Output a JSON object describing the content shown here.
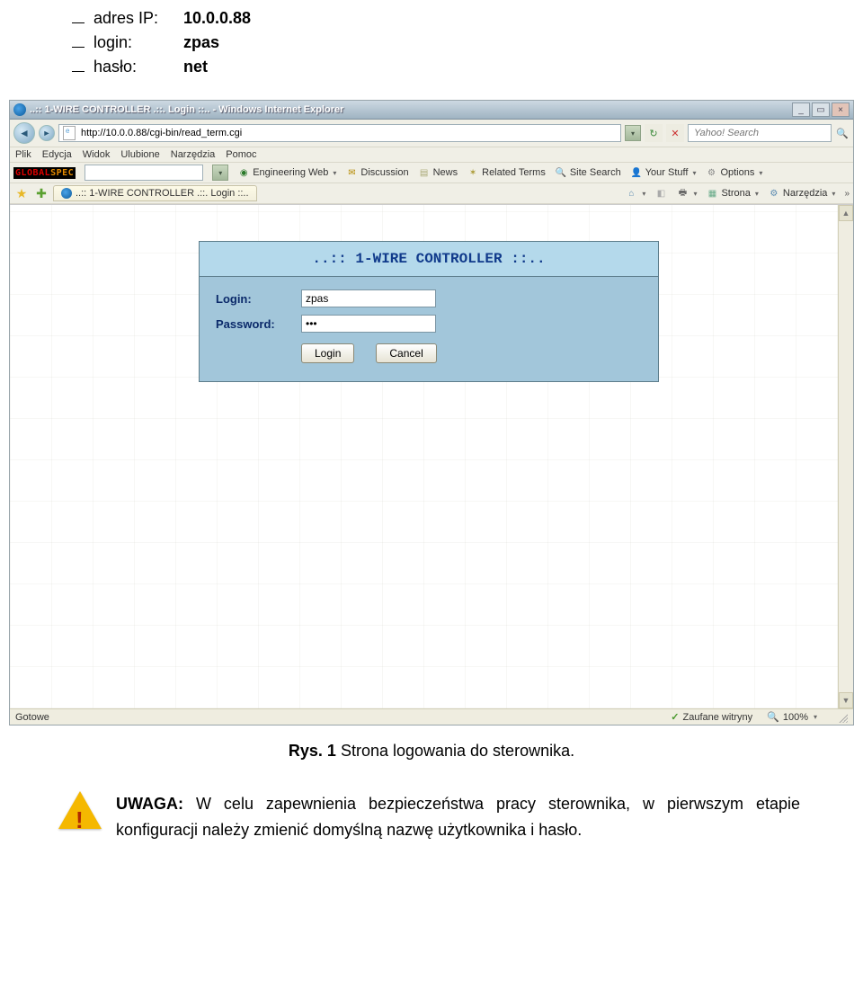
{
  "doc_top": {
    "ip_label": "adres IP:",
    "ip_value": "10.0.0.88",
    "login_label": "login:",
    "login_value": "zpas",
    "password_label": "hasło:",
    "password_value": "net"
  },
  "browser": {
    "window_title": "..:: 1-WIRE CONTROLLER .::. Login ::.. - Windows Internet Explorer",
    "url": "http://10.0.0.88/cgi-bin/read_term.cgi",
    "search_placeholder": "Yahoo! Search",
    "menu": {
      "file": "Plik",
      "edit": "Edycja",
      "view": "Widok",
      "favorites": "Ulubione",
      "tools": "Narzędzia",
      "help": "Pomoc"
    },
    "toolbar": {
      "eng_web": "Engineering Web",
      "discussion": "Discussion",
      "news": "News",
      "related": "Related Terms",
      "site_search": "Site Search",
      "your_stuff": "Your Stuff",
      "options": "Options"
    },
    "tab_title": "..:: 1-WIRE CONTROLLER .::. Login ::..",
    "right_tools": {
      "strona": "Strona",
      "narzedzia": "Narzędzia"
    },
    "status_left": "Gotowe",
    "trusted": "Zaufane witryny",
    "zoom": "100%"
  },
  "login_panel": {
    "header": "..:: 1-WIRE CONTROLLER ::..",
    "login_label": "Login:",
    "login_value": "zpas",
    "password_label": "Password:",
    "password_value": "•••",
    "login_btn": "Login",
    "cancel_btn": "Cancel"
  },
  "caption": {
    "prefix": "Rys. 1",
    "text": " Strona logowania do sterownika."
  },
  "warning": {
    "prefix": "UWAGA:",
    "text": " W celu zapewnienia bezpieczeństwa pracy sterownika, w pierwszym etapie konfiguracji należy zmienić domyślną nazwę użytkownika i hasło."
  }
}
